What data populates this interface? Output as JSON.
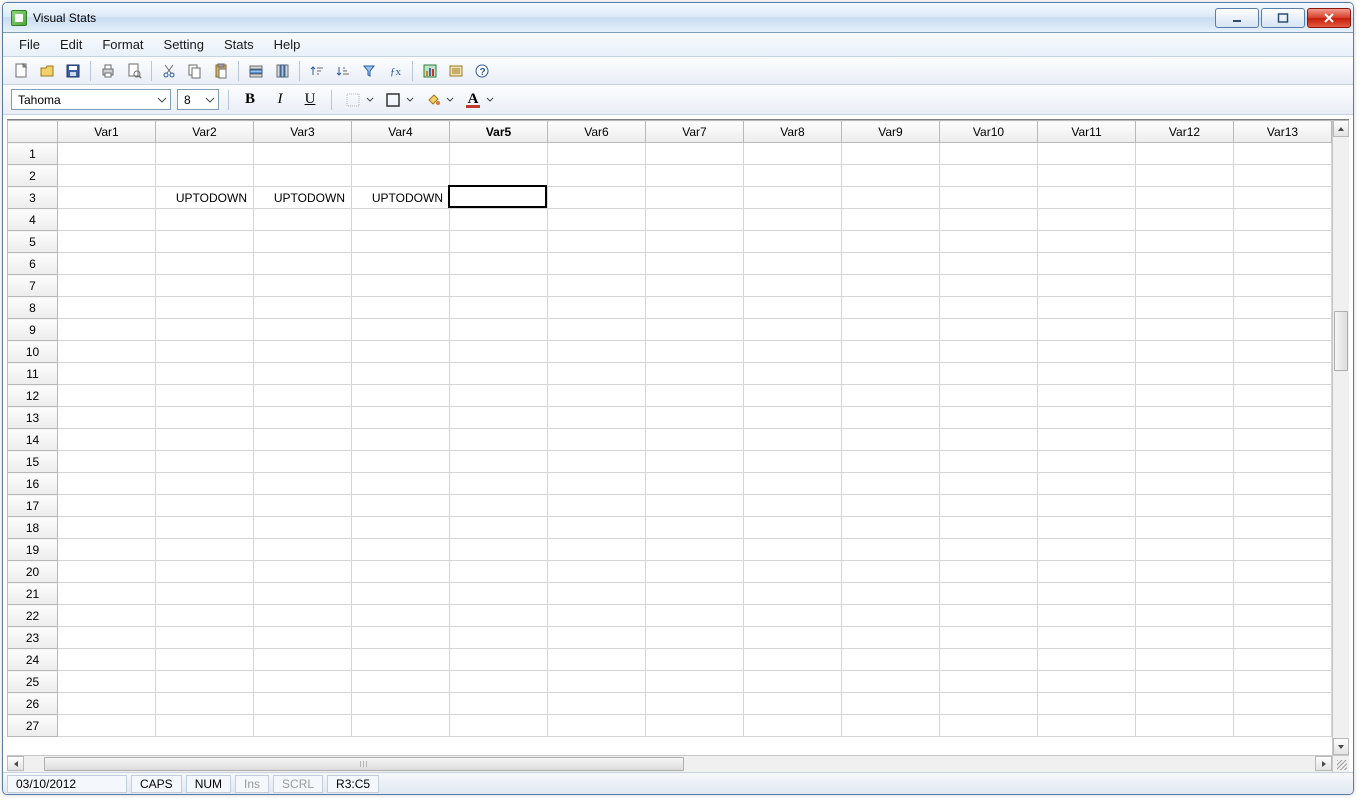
{
  "window": {
    "title": "Visual Stats"
  },
  "menu": {
    "items": [
      "File",
      "Edit",
      "Format",
      "Setting",
      "Stats",
      "Help"
    ]
  },
  "format": {
    "font_name": "Tahoma",
    "font_size": "8",
    "bold_label": "B",
    "italic_label": "I",
    "underline_label": "U",
    "font_color_label": "A"
  },
  "grid": {
    "columns": [
      "Var1",
      "Var2",
      "Var3",
      "Var4",
      "Var5",
      "Var6",
      "Var7",
      "Var8",
      "Var9",
      "Var10",
      "Var11",
      "Var12",
      "Var13"
    ],
    "selected_col_index": 4,
    "row_count": 27,
    "selected_cell": {
      "row": 3,
      "col": 5
    },
    "cells": {
      "3": {
        "2": "UPTODOWN",
        "3": "UPTODOWN",
        "4": "UPTODOWN"
      }
    }
  },
  "status": {
    "date": "03/10/2012",
    "caps": "CAPS",
    "num": "NUM",
    "ins": "Ins",
    "scrl": "SCRL",
    "cellref": "R3:C5"
  }
}
